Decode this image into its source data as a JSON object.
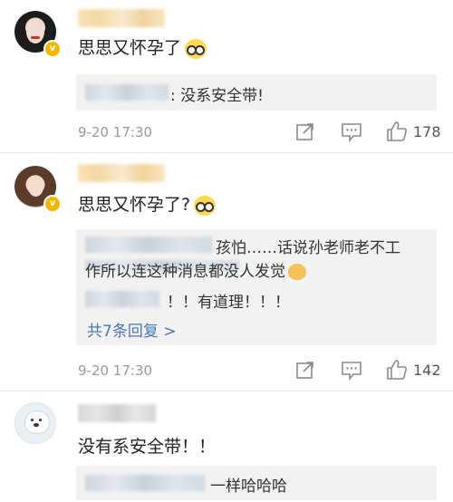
{
  "comments": [
    {
      "text": "思思又怀孕了",
      "replies": [
        {
          "text": ": 没系安全带!"
        }
      ],
      "time": "9-20 17:30",
      "likes": "178"
    },
    {
      "text": "思思又怀孕了?",
      "replies": [
        {
          "text": "孩怕……话说孙老师老不工"
        },
        {
          "text": "作所以连这种消息都没人发觉"
        },
        {
          "text": "！！有道理！！！"
        }
      ],
      "more_replies": "共7条回复 >",
      "time": "9-20 17:30",
      "likes": "142"
    },
    {
      "text": "没有系安全带！！",
      "replies": [
        {
          "text": "一样哈哈哈"
        }
      ]
    }
  ],
  "icons": [
    "share-icon",
    "comment-icon",
    "like-icon",
    "verified-badge-icon",
    "glasses-emoji-icon",
    "cat-emoji-icon"
  ],
  "colors": {
    "link": "#4a77b4",
    "meta": "#9a9a9a",
    "reply_bg": "#f2f2f2",
    "badge": "#f7b500"
  }
}
